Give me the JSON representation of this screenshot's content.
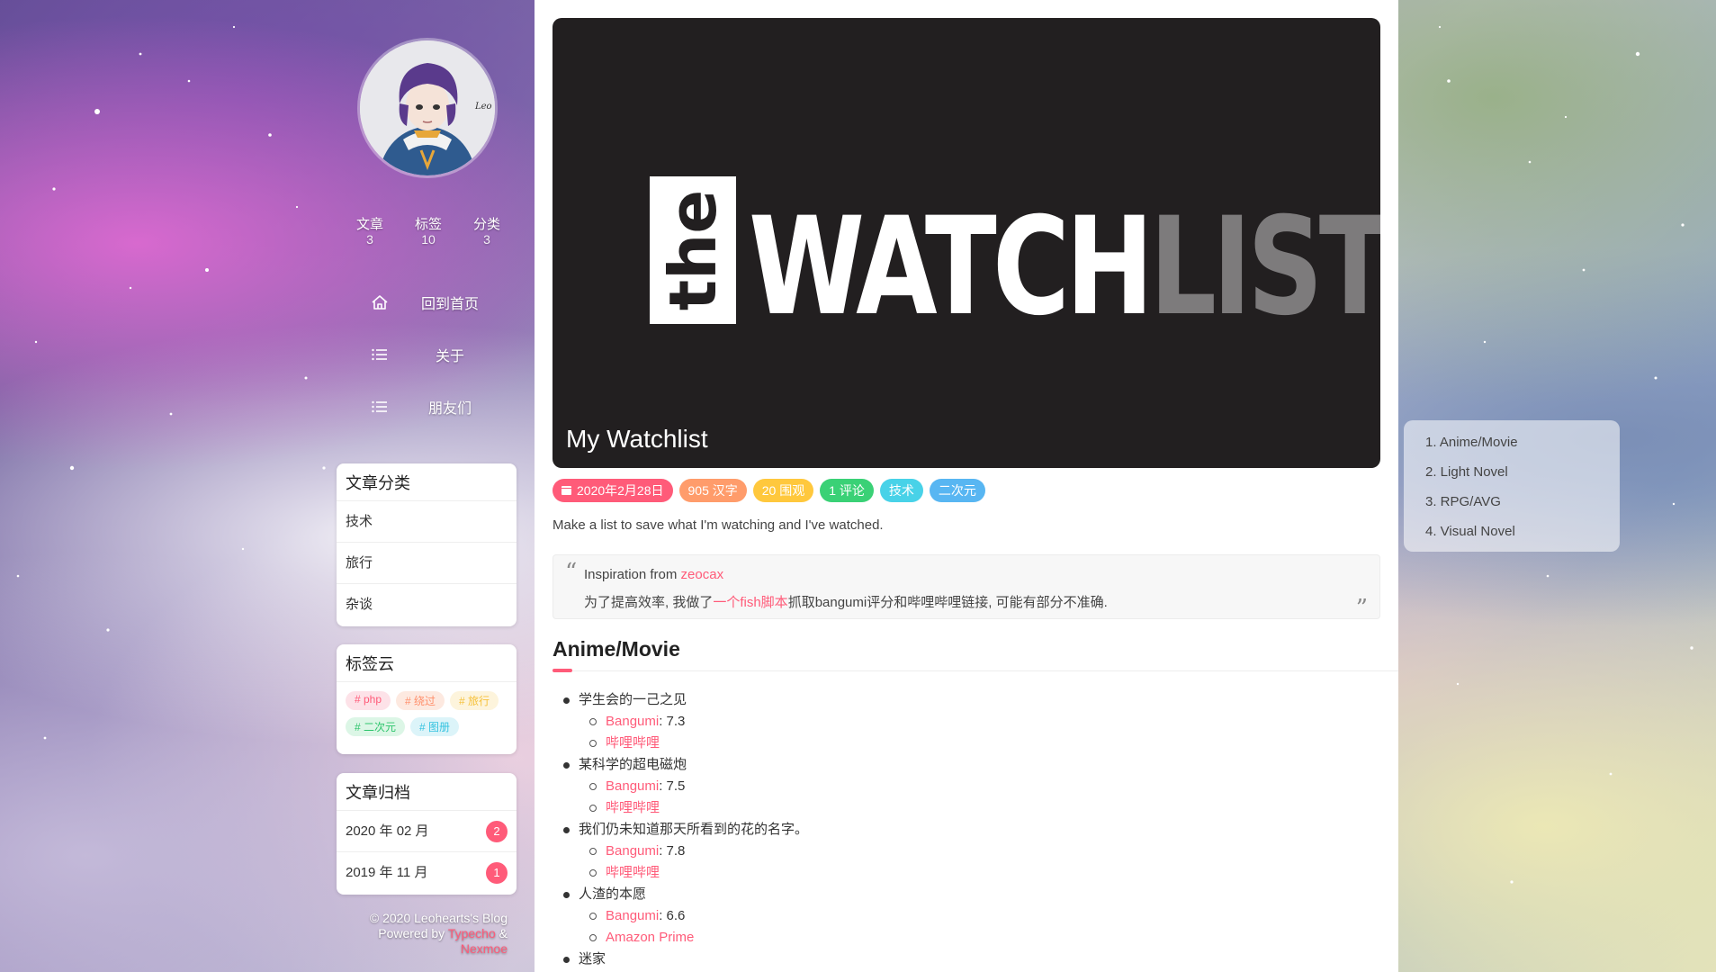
{
  "sidebar": {
    "avatar_signature": "Leo",
    "stats": [
      {
        "label": "文章",
        "count": "3"
      },
      {
        "label": "标签",
        "count": "10"
      },
      {
        "label": "分类",
        "count": "3"
      }
    ],
    "nav": [
      {
        "label": "回到首页",
        "icon": "home-icon"
      },
      {
        "label": "关于",
        "icon": "list-icon"
      },
      {
        "label": "朋友们",
        "icon": "list-icon"
      }
    ],
    "categories": {
      "title": "文章分类",
      "items": [
        "技术",
        "旅行",
        "杂谈"
      ]
    },
    "tag_cloud": {
      "title": "标签云",
      "tags": [
        {
          "label": "# php",
          "bg": "#fde2e8",
          "fg": "#ff5b79"
        },
        {
          "label": "# 绕过",
          "bg": "#fde9e0",
          "fg": "#ff8f6b"
        },
        {
          "label": "# 旅行",
          "bg": "#fdf4dc",
          "fg": "#f6c13b"
        },
        {
          "label": "# 二次元",
          "bg": "#dcf6e6",
          "fg": "#2ec56c"
        },
        {
          "label": "# 图册",
          "bg": "#dcf4f9",
          "fg": "#36c3e0"
        }
      ]
    },
    "archive": {
      "title": "文章归档",
      "items": [
        {
          "label": "2020 年 02 月",
          "count": "2"
        },
        {
          "label": "2019 年 11 月",
          "count": "1"
        }
      ]
    },
    "footer": {
      "copyright": "© 2020 Leohearts's Blog",
      "powered_prefix": "Powered by",
      "typecho": "Typecho",
      "amp": "&",
      "nexmoe": "Nexmoe"
    }
  },
  "post": {
    "hero_logo_the": "the",
    "hero_logo_watch": "WATCH",
    "hero_logo_list": "LIST",
    "title": "My Watchlist",
    "chips": [
      {
        "label": "2020年2月28日",
        "color": "#ff5b79",
        "icon": "calendar-icon"
      },
      {
        "label": "905 汉字",
        "color": "#ff9c6b"
      },
      {
        "label": "20 围观",
        "color": "#ffc83d"
      },
      {
        "label": "1 评论",
        "color": "#3ad176"
      },
      {
        "label": "技术",
        "color": "#48d2e8"
      },
      {
        "label": "二次元",
        "color": "#58b6f2"
      }
    ],
    "intro": "Make a list to save what I'm watching and I've watched.",
    "quote": {
      "line1_prefix": "Inspiration from",
      "line1_link": "zeocax",
      "line2_prefix": "为了提高效率, 我做了",
      "line2_link": "一个fish脚本",
      "line2_suffix": "抓取bangumi评分和哔哩哔哩链接, 可能有部分不准确."
    },
    "section_heading": "Anime/Movie",
    "list": [
      {
        "title": "学生会的一己之见",
        "rating_label": "Bangumi",
        "rating": ": 7.3",
        "link": "哔哩哔哩"
      },
      {
        "title": "某科学的超电磁炮",
        "rating_label": "Bangumi",
        "rating": ": 7.5",
        "link": "哔哩哔哩"
      },
      {
        "title": "我们仍未知道那天所看到的花的名字。",
        "rating_label": "Bangumi",
        "rating": ": 7.8",
        "link": "哔哩哔哩"
      },
      {
        "title": "人渣的本愿",
        "rating_label": "Bangumi",
        "rating": ": 6.6",
        "link": "Amazon Prime"
      },
      {
        "title": "迷家"
      }
    ]
  },
  "toc": {
    "items": [
      "1. Anime/Movie",
      "2. Light Novel",
      "3. RPG/AVG",
      "4. Visual Novel"
    ]
  }
}
